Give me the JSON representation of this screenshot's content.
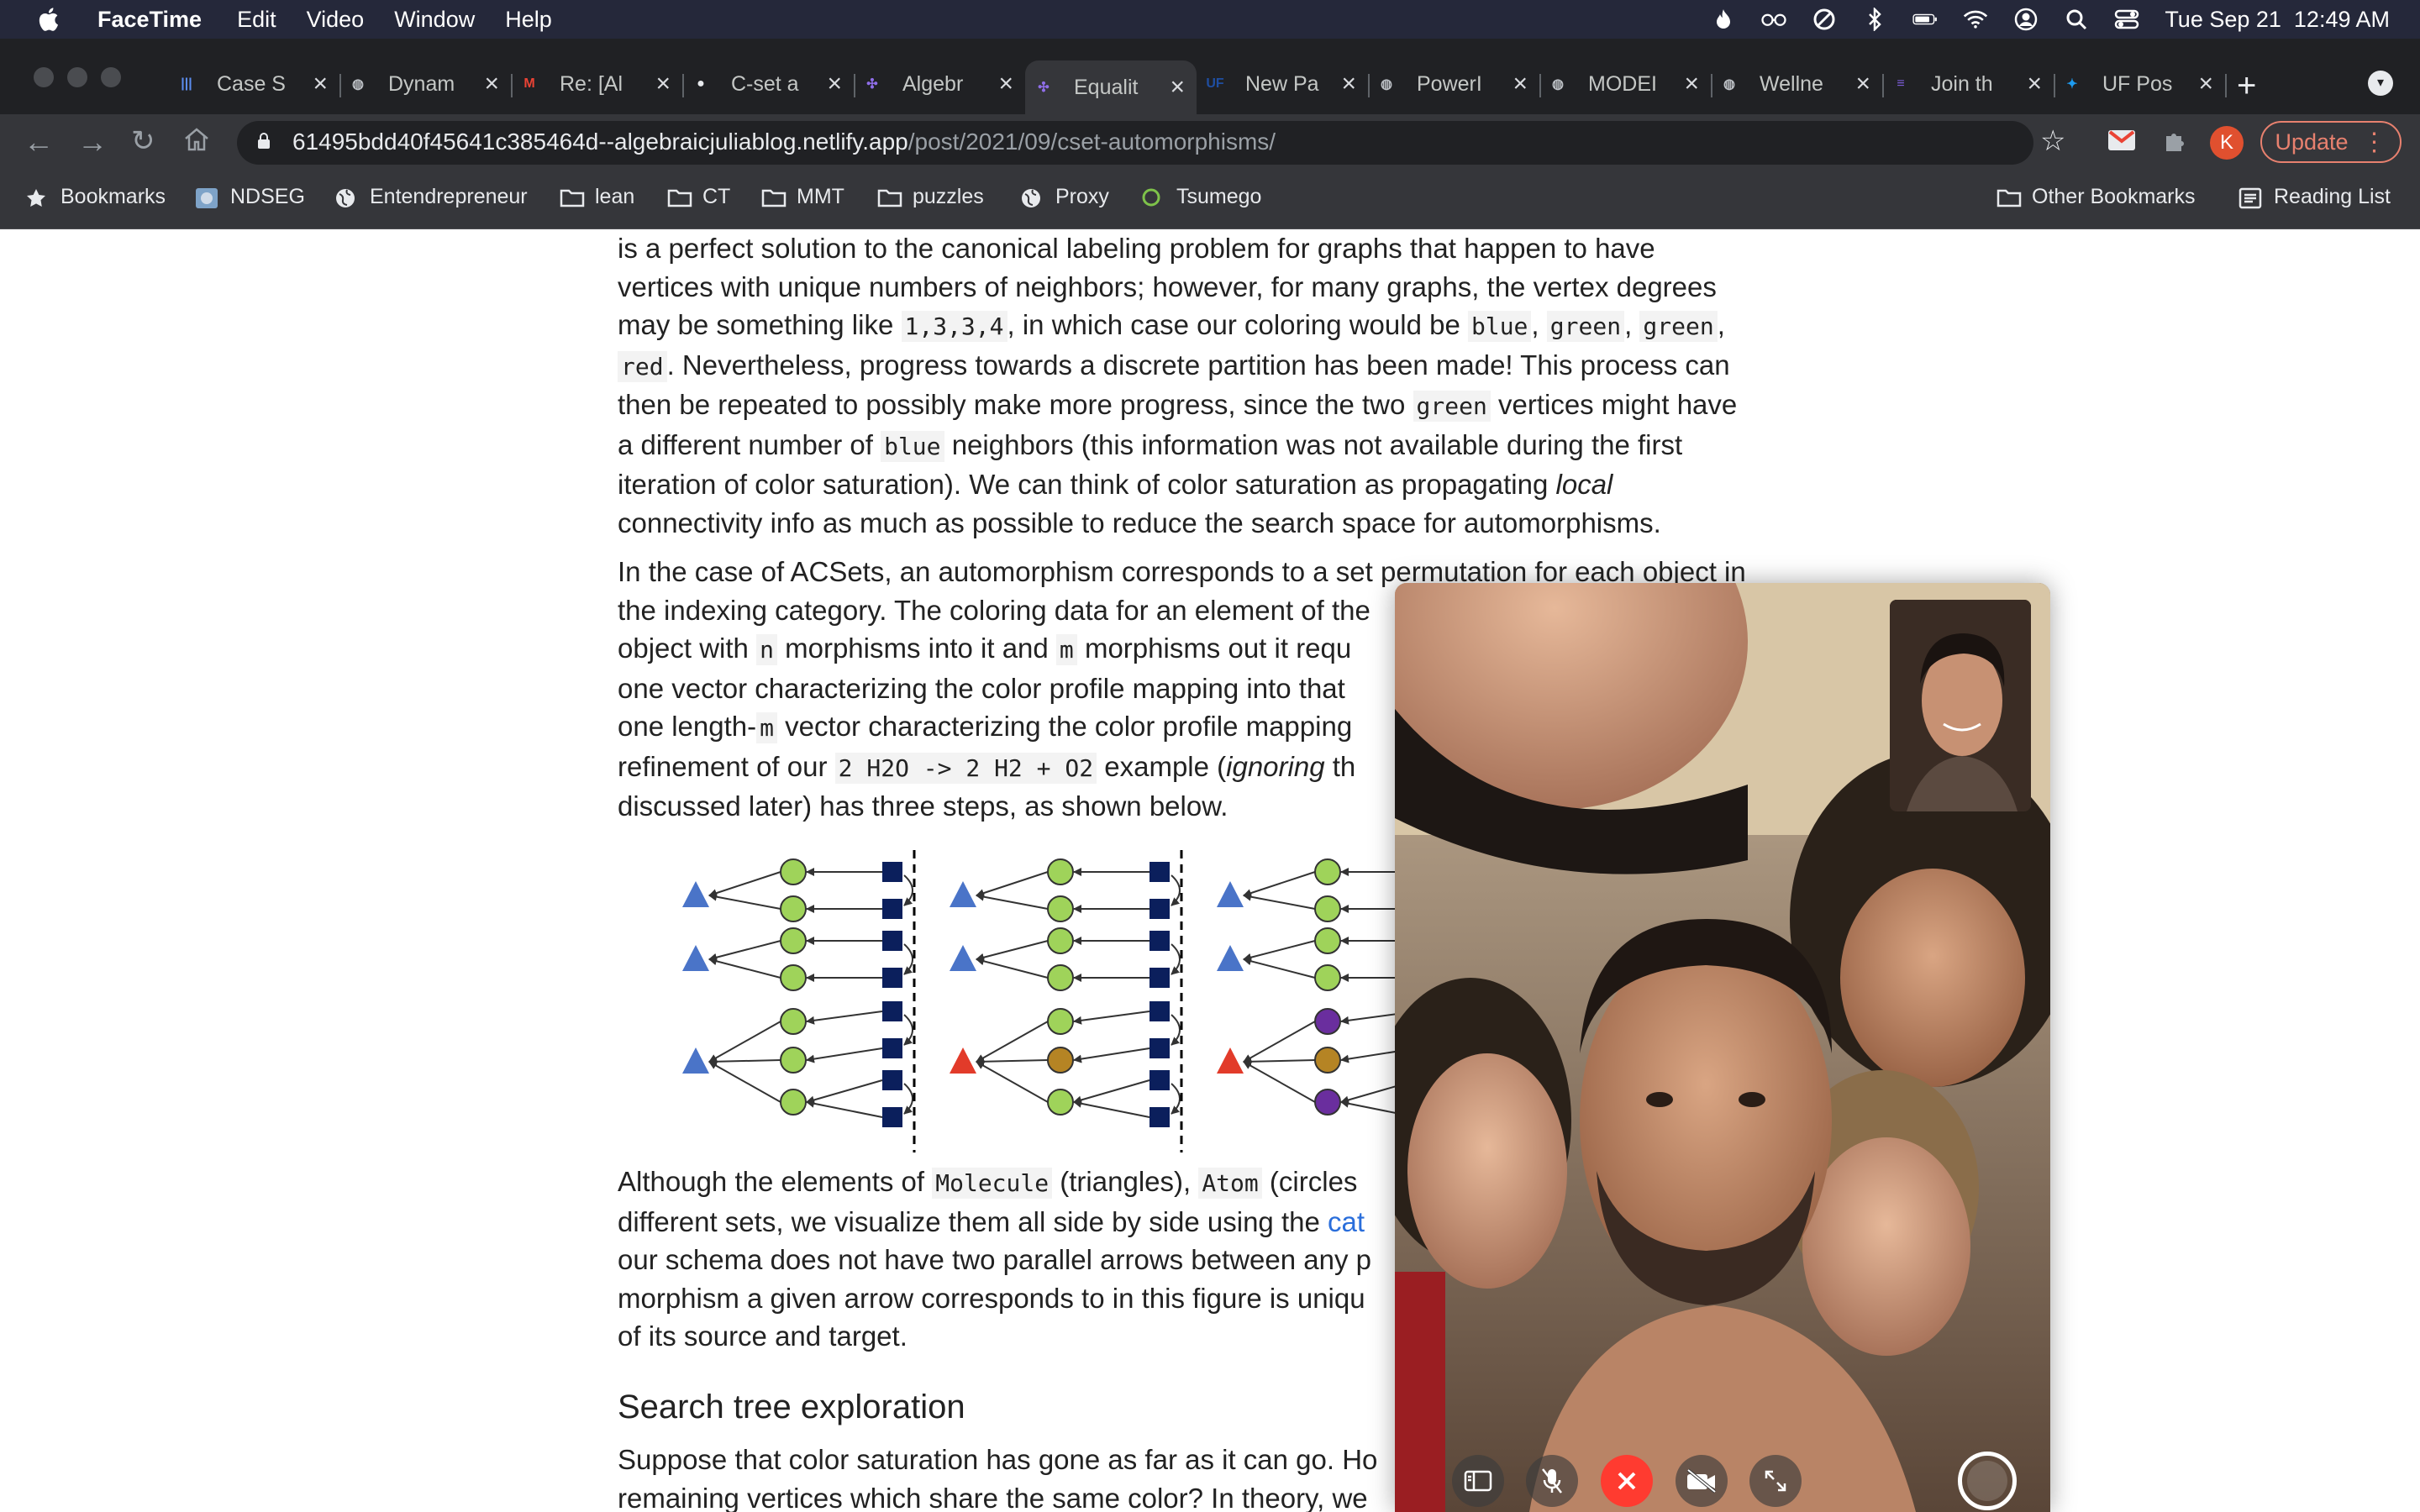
{
  "menubar": {
    "app_name": "FaceTime",
    "menus": [
      "Edit",
      "Video",
      "Window",
      "Help"
    ],
    "status_icons": [
      "flame-icon",
      "reading-glasses-icon",
      "do-not-disturb-icon",
      "bluetooth-icon",
      "battery-icon",
      "wifi-icon",
      "user-account-icon",
      "spotlight-search-icon",
      "control-center-icon"
    ],
    "datetime": "Tue Sep 21  12:49 AM"
  },
  "browser": {
    "tabs": [
      {
        "label": "Case S",
        "icon": "bar-chart-icon",
        "color": "#5b8def"
      },
      {
        "label": "Dynam",
        "icon": "globe-icon",
        "color": "#bdc1c6"
      },
      {
        "label": "Re: [Al",
        "icon": "gmail-icon",
        "color": "#ea4335"
      },
      {
        "label": "C-set a",
        "icon": "github-icon",
        "color": "#e8eaed"
      },
      {
        "label": "Algebr",
        "icon": "algebraicjulia-icon",
        "color": "#8f6ee8"
      },
      {
        "label": "Equalit",
        "icon": "algebraicjulia-icon",
        "color": "#8f6ee8",
        "active": true
      },
      {
        "label": "New Pa",
        "icon": "uf-icon",
        "color": "#1f4ea1"
      },
      {
        "label": "PowerI",
        "icon": "globe-icon",
        "color": "#bdc1c6"
      },
      {
        "label": "MODEI",
        "icon": "globe-icon",
        "color": "#bdc1c6"
      },
      {
        "label": "Wellne",
        "icon": "globe-icon",
        "color": "#bdc1c6"
      },
      {
        "label": "Join th",
        "icon": "list-icon",
        "color": "#7b5cd6"
      },
      {
        "label": "UF Pos",
        "icon": "twitter-icon",
        "color": "#1d9bf0"
      }
    ],
    "url_host": "61495bdd40f45641c385464d--algebraicjuliablog.netlify.app",
    "url_path": "/post/2021/09/cset-automorphisms/",
    "profile_initial": "K",
    "update_label": "Update",
    "bookmarks": [
      {
        "label": "Bookmarks",
        "icon": "star-icon"
      },
      {
        "label": "NDSEG",
        "icon": "site-icon"
      },
      {
        "label": "Entendrepreneur",
        "icon": "globe-icon"
      },
      {
        "label": "lean",
        "icon": "folder-icon"
      },
      {
        "label": "CT",
        "icon": "folder-icon"
      },
      {
        "label": "MMT",
        "icon": "folder-icon"
      },
      {
        "label": "puzzles",
        "icon": "folder-icon"
      },
      {
        "label": "Proxy",
        "icon": "globe-icon"
      },
      {
        "label": "Tsumego",
        "icon": "circle-icon"
      }
    ],
    "bookmarks_right": [
      {
        "label": "Other Bookmarks",
        "icon": "folder-icon"
      },
      {
        "label": "Reading List",
        "icon": "reading-list-icon"
      }
    ]
  },
  "article": {
    "p1_line1": "is a perfect solution to the canonical labeling problem for graphs that happen to have",
    "p1_line2": "vertices with unique numbers of neighbors; however, for many graphs, the vertex degrees",
    "p1_line3a": "may be something like ",
    "p1_code_degrees": "1,3,3,4",
    "p1_line3b": ", in which case our coloring would be ",
    "p1_code_blue": "blue",
    "p1_sep1": ", ",
    "p1_code_green": "green",
    "p1_sep2": ", ",
    "p1_code_green2": "green",
    "p1_sep3": ",",
    "p1_code_red": "red",
    "p1_line4": ". Nevertheless, progress towards a discrete partition has been made! This process can",
    "p1_line5a": "then be repeated to possibly make more progress, since the two ",
    "p1_code_green3": "green",
    "p1_line5b": " vertices might have",
    "p1_line6a": "a different number of ",
    "p1_code_blue2": "blue",
    "p1_line6b": " neighbors (this information was not available during the first",
    "p1_line7a": "iteration of color saturation). We can think of color saturation as propagating ",
    "p1_line7_em": "local",
    "p1_line8": "connectivity info as much as possible to reduce the search space for automorphisms.",
    "p2_line1": "In the case of ACSets, an automorphism corresponds to a set permutation for each object in",
    "p2_line2": "the indexing category. The coloring data for an element of the",
    "p2_line3a": "object with ",
    "p2_code_n": "n",
    "p2_line3b": " morphisms into it and ",
    "p2_code_m": "m",
    "p2_line3c": " morphisms out it requ",
    "p2_line4": "one vector characterizing the color profile mapping into that",
    "p2_line5a": "one length-",
    "p2_code_m2": "m",
    "p2_line5b": " vector characterizing the color profile mapping",
    "p2_line6a": "refinement of our ",
    "p2_code_reaction": "2 H2O -> 2 H2 + O2",
    "p2_line6b": " example (",
    "p2_line6_em": "ignoring",
    "p2_line6c": " th",
    "p2_line7": "discussed later) has three steps, as shown below.",
    "p3_line1a": "Although the elements of ",
    "p3_code_molecule": "Molecule",
    "p3_line1b": " (triangles), ",
    "p3_code_atom": "Atom",
    "p3_line1c": " (circles",
    "p3_line2a": "different sets, we visualize them all side by side using the ",
    "p3_link": "cat",
    "p3_line3": "our schema does not have two parallel arrows between any p",
    "p3_line4": "morphism a given arrow corresponds to in this figure is uniqu",
    "p3_line5": "of its source and target.",
    "h2": "Search tree exploration",
    "p4_line1": "Suppose that color saturation has gone as far as it can go. Ho",
    "p4_line2": "remaining vertices which share the same color? In theory, we"
  },
  "figure": {
    "colors": {
      "blue": "#4a74c8",
      "red": "#e23b2a",
      "green": "#9fd35a",
      "brown": "#b58424",
      "purple": "#6a2e9e",
      "navy": "#0b1f5c"
    },
    "panels": [
      {
        "triangles": [
          "blue",
          "blue",
          "blue"
        ],
        "circles": [
          "green",
          "green",
          "green",
          "green",
          "green",
          "green",
          "green"
        ]
      },
      {
        "triangles": [
          "blue",
          "blue",
          "red"
        ],
        "circles": [
          "green",
          "green",
          "green",
          "green",
          "green",
          "brown",
          "green"
        ]
      },
      {
        "triangles": [
          "blue",
          "blue",
          "red"
        ],
        "circles": [
          "green",
          "green",
          "green",
          "green",
          "purple",
          "brown",
          "purple"
        ]
      }
    ]
  },
  "facetime": {
    "controls": [
      "sidebar-icon",
      "mute-microphone-icon",
      "end-call-icon",
      "camera-off-icon",
      "fullscreen-icon",
      "shutter-icon"
    ],
    "end_call_color": "#ff3b30"
  }
}
